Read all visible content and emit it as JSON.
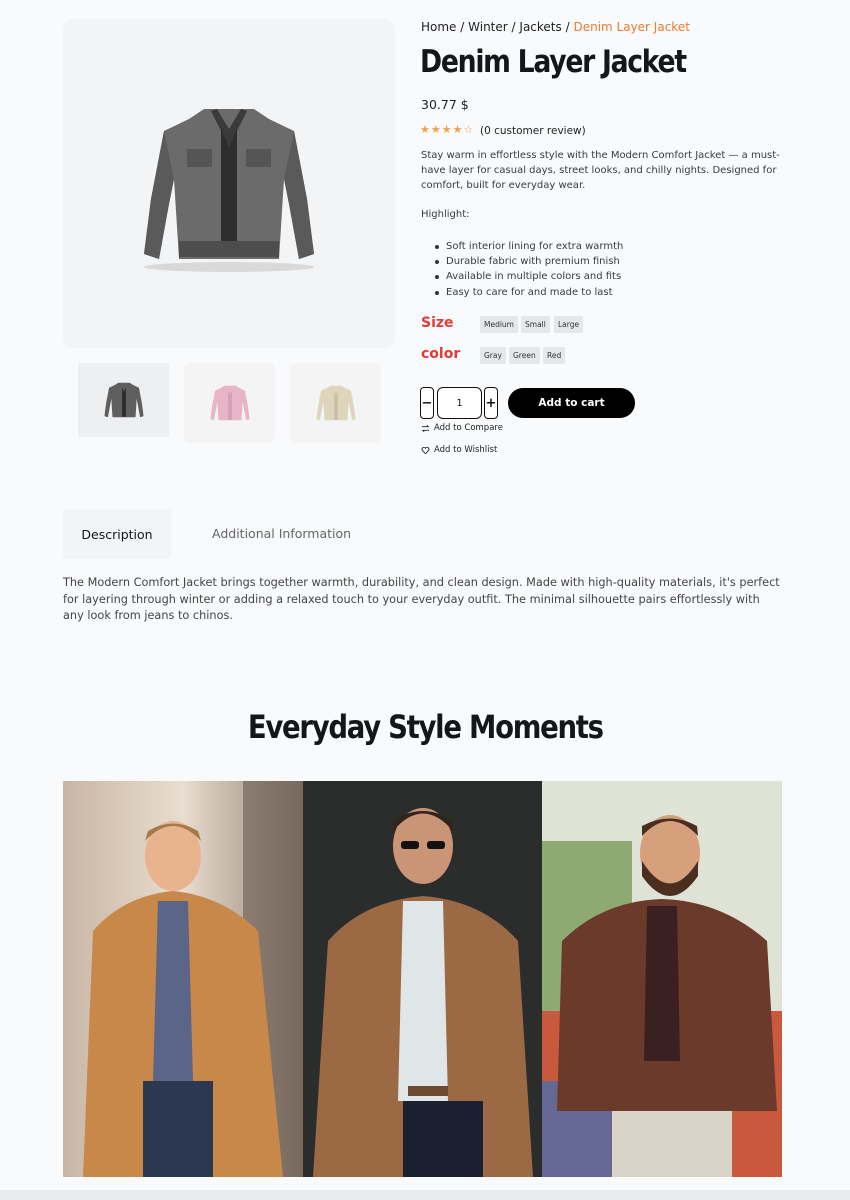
{
  "breadcrumb": {
    "home": "Home",
    "winter": "Winter",
    "jackets": "Jackets",
    "current": "Denim Layer Jacket",
    "separator": "/"
  },
  "product": {
    "title": "Denim Layer Jacket",
    "price": "30.77 $",
    "rating": 4,
    "rating_max": 5,
    "review_text": "(0 customer review)",
    "description": "Stay warm in effortless style with the Modern Comfort Jacket — a must-have layer for casual days, street looks, and chilly nights. Designed for comfort, built for everyday wear.",
    "highlight_title": "Highlight:",
    "highlights": [
      "Soft interior lining for extra warmth",
      "Durable fabric with premium finish",
      "Available in multiple colors and fits",
      "Easy to care for and made to last"
    ],
    "thumbnails": [
      "gray-jacket",
      "pink-jacket",
      "beige-jacket"
    ]
  },
  "options": {
    "size_label": "Size",
    "sizes": [
      "Medium",
      "Small",
      "Large"
    ],
    "color_label": "color",
    "colors": [
      "Gray",
      "Green",
      "Red"
    ]
  },
  "cart": {
    "minus": "−",
    "plus": "+",
    "quantity": "1",
    "add_to_cart": "Add to cart",
    "compare": "Add to Compare",
    "wishlist": "Add to Wishlist"
  },
  "tabs": {
    "description": "Description",
    "additional": "Additional Information"
  },
  "long_description": "The Modern Comfort Jacket brings together warmth, durability, and clean design. Made with high-quality materials, it's perfect for layering through winter or adding a relaxed touch to your everyday outfit. The minimal silhouette pairs effortlessly with any look from jeans to chinos.",
  "gallery": {
    "title": "Everyday Style Moments"
  },
  "colors": {
    "accent": "#f07a2a",
    "option_label": "#e53935",
    "button_bg": "#000000",
    "star": "#f5a04a"
  }
}
